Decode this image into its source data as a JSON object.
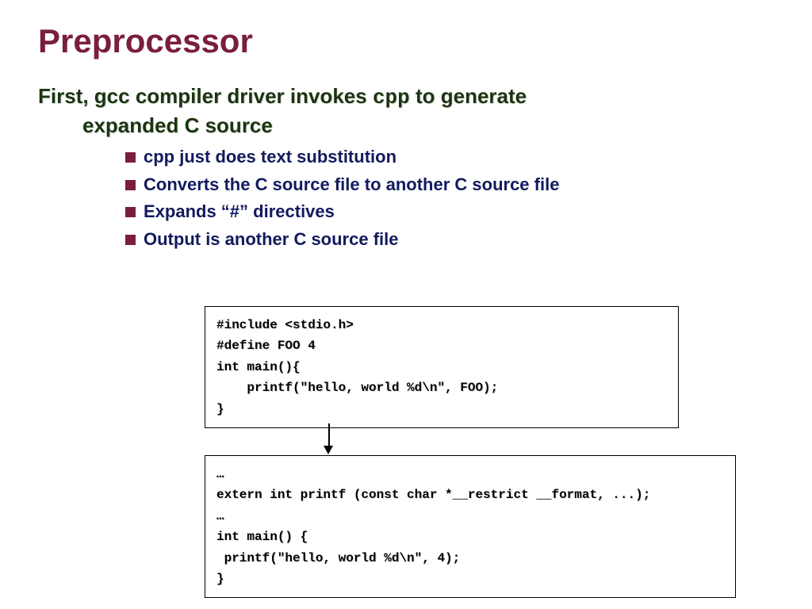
{
  "title": "Preprocessor",
  "subtitle": {
    "part1": "First, gcc compiler driver invokes ",
    "mono": "cpp",
    "part2": " to generate",
    "line2": "expanded C source"
  },
  "bullets": [
    "cpp just does text substitution",
    "Converts the C source file to another C source file",
    "Expands “#” directives",
    "Output is another  C source file"
  ],
  "code1": "#include <stdio.h>\n#define FOO 4\nint main(){\n    printf(\"hello, world %d\\n\", FOO);\n}",
  "code2": "…\nextern int printf (const char *__restrict __format, ...);\n…\nint main() {\n printf(\"hello, world %d\\n\", 4);\n}"
}
